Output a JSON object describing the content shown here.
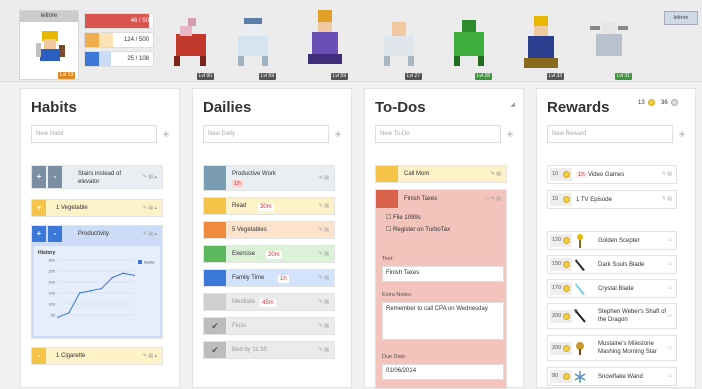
{
  "header": {
    "username": "lefnire",
    "user_level": "Lvl 13",
    "stats": [
      {
        "label": "46 / 50",
        "icon": "heart-icon",
        "color": "#d9534f",
        "fill": 0.92
      },
      {
        "label": "124 / 500",
        "icon": "star-icon",
        "color": "#f0ad4e",
        "fill": 0.25
      },
      {
        "label": "25 / 108",
        "icon": "mana-icon",
        "color": "#3b78d8",
        "fill": 0.23
      }
    ],
    "party": [
      {
        "level": "Lvl 90",
        "green": false
      },
      {
        "level": "Lvl 69",
        "green": false
      },
      {
        "level": "Lvl 59",
        "green": false
      },
      {
        "level": "Lvl 27",
        "green": false
      },
      {
        "level": "Lvl 28",
        "green": true
      },
      {
        "level": "Lvl 33",
        "green": false
      },
      {
        "level": "Lvl 31",
        "green": false
      }
    ],
    "menu_label": "lefnire"
  },
  "habits": {
    "title": "Habits",
    "placeholder": "New Habit",
    "items": [
      {
        "text": "Stairs instead of elevator"
      },
      {
        "text": "1 Vegetable"
      },
      {
        "text": "Productivity"
      },
      {
        "text": "1 Cigarette"
      }
    ],
    "chart": {
      "title": "History",
      "legend": "Score",
      "yticks": [
        "300",
        "250",
        "200",
        "150",
        "100",
        "50"
      ]
    },
    "chart_data": {
      "type": "line",
      "title": "History",
      "series": [
        {
          "name": "Score",
          "values": [
            40,
            60,
            150,
            160,
            170,
            220,
            240,
            230
          ]
        }
      ],
      "ylim": [
        0,
        300
      ]
    }
  },
  "dailies": {
    "title": "Dailies",
    "placeholder": "New Daily",
    "items": [
      {
        "text": "Productive Work",
        "tag": "1h"
      },
      {
        "text": "Read",
        "tag": "30m"
      },
      {
        "text": "5 Vegetables",
        "tag": ""
      },
      {
        "text": "Exercise",
        "tag": "20m"
      },
      {
        "text": "Family Time",
        "tag": "1h"
      },
      {
        "text": "Meditate",
        "tag": "45m"
      },
      {
        "text": "Floss",
        "tag": ""
      },
      {
        "text": "Bed by 11:30",
        "tag": ""
      }
    ]
  },
  "todos": {
    "title": "To-Dos",
    "placeholder": "New To-Do",
    "items": [
      {
        "text": "Call Mom"
      },
      {
        "text": "Finish Taxes"
      }
    ],
    "checklist": [
      "File 1099s",
      "Register on TurboTax"
    ],
    "text_label": "Text:",
    "text_value": "Finish Taxes",
    "notes_label": "Extra Notes:",
    "notes_value": "Remember to call CPA on Wednesday",
    "due_label": "Due Date:",
    "due_value": "01/06/2014"
  },
  "rewards": {
    "title": "Rewards",
    "gold": "13",
    "silver": "36",
    "placeholder": "New Reward",
    "custom": [
      {
        "price": "10",
        "text": "Video Games",
        "tag": "1h"
      },
      {
        "price": "10",
        "text": "1 TV Episode",
        "tag": ""
      }
    ],
    "items": [
      {
        "price": "120",
        "text": "Golden Scepter"
      },
      {
        "price": "150",
        "text": "Dark Souls Blade"
      },
      {
        "price": "170",
        "text": "Crystal Blade"
      },
      {
        "price": "200",
        "text": "Stephen Weber's Shaft of the Dragon"
      },
      {
        "price": "200",
        "text": "Mustaine's Milestone Mashing Morning Star"
      },
      {
        "price": "90",
        "text": "Snowflake Wand"
      }
    ]
  }
}
